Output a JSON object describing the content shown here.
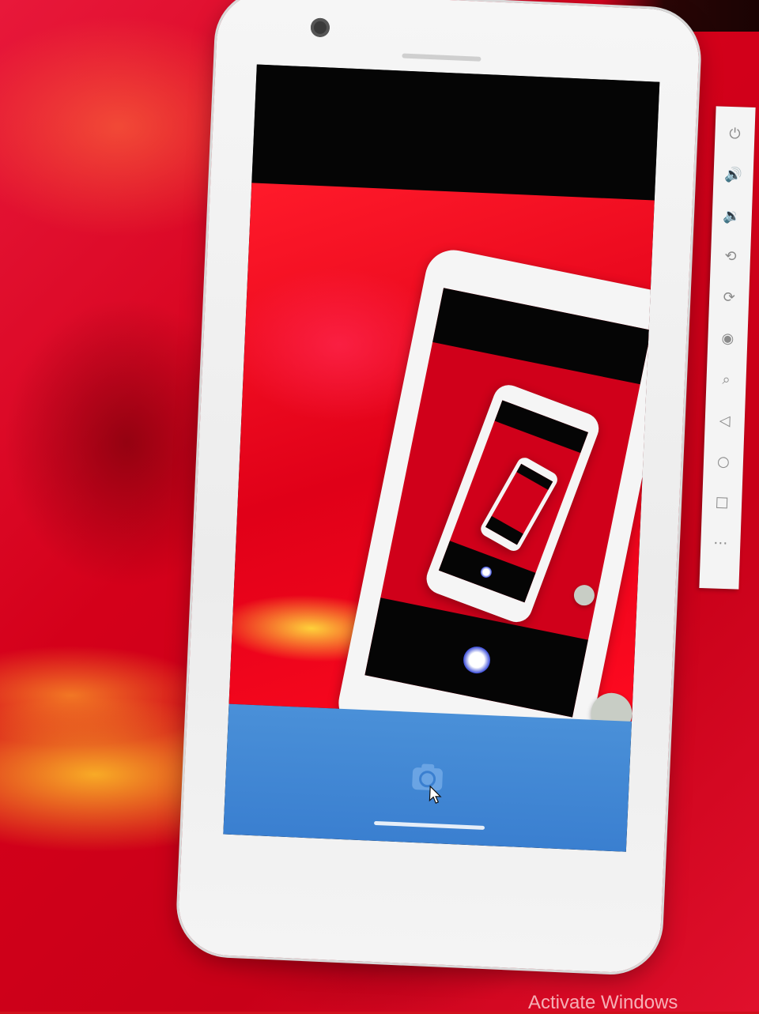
{
  "emulator": {
    "toolbar_icons": [
      {
        "name": "power-icon",
        "glyph": "⏻"
      },
      {
        "name": "volume-up-icon",
        "glyph": "🔊"
      },
      {
        "name": "volume-down-icon",
        "glyph": "🔉"
      },
      {
        "name": "rotate-left-icon",
        "glyph": "⟲"
      },
      {
        "name": "rotate-right-icon",
        "glyph": "⟳"
      },
      {
        "name": "screenshot-icon",
        "glyph": "◉"
      },
      {
        "name": "zoom-icon",
        "glyph": "⌕"
      },
      {
        "name": "back-icon",
        "glyph": "◁"
      },
      {
        "name": "home-icon",
        "glyph": "○"
      },
      {
        "name": "overview-icon",
        "glyph": "□"
      },
      {
        "name": "more-icon",
        "glyph": "⋯"
      }
    ]
  },
  "camera_app": {
    "shutter_icon": "camera-icon",
    "more_label": "•••",
    "accent_color": "#3a7fd0"
  },
  "desktop": {
    "watermark": "Activate Windows"
  }
}
